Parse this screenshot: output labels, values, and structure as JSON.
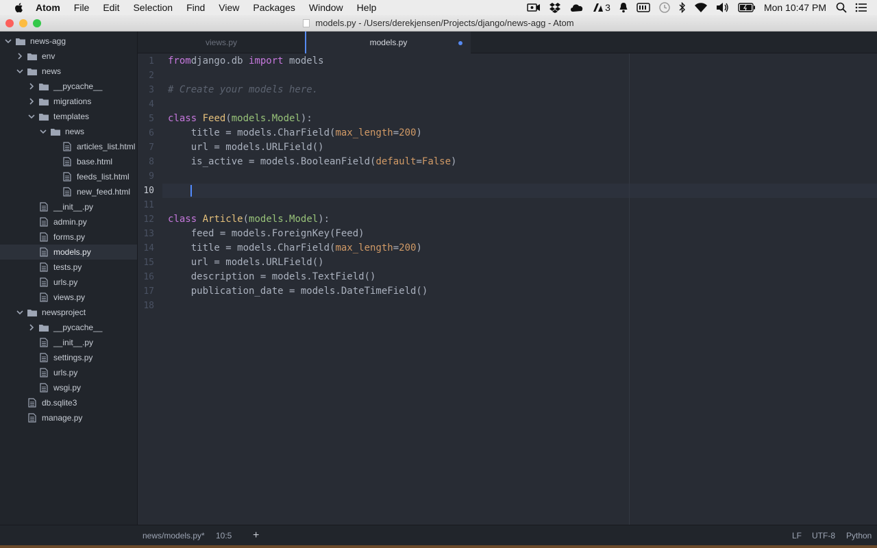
{
  "menubar": {
    "app_name": "Atom",
    "items": [
      "File",
      "Edit",
      "Selection",
      "Find",
      "View",
      "Packages",
      "Window",
      "Help"
    ],
    "status_icons": [
      "video-icon",
      "dropbox-icon",
      "cloud-icon",
      "adobe-icon",
      "notification-bell-icon",
      "keyboard-icon",
      "time-machine-icon",
      "bluetooth-icon",
      "wifi-icon",
      "volume-icon",
      "battery-icon"
    ],
    "adobe_count": "3",
    "clock": "Mon 10:47 PM"
  },
  "window": {
    "title": "models.py - /Users/derekjensen/Projects/django/news-agg - Atom",
    "traffic_lights": {
      "close": "#fc605b",
      "minimize": "#fdbc40",
      "zoom": "#34c84a"
    }
  },
  "tree": {
    "root": "news-agg",
    "items": [
      {
        "label": "env",
        "type": "folder",
        "expanded": false,
        "depth": 1
      },
      {
        "label": "news",
        "type": "folder",
        "expanded": true,
        "depth": 1
      },
      {
        "label": "__pycache__",
        "type": "folder",
        "expanded": false,
        "depth": 2
      },
      {
        "label": "migrations",
        "type": "folder",
        "expanded": false,
        "depth": 2
      },
      {
        "label": "templates",
        "type": "folder",
        "expanded": true,
        "depth": 2
      },
      {
        "label": "news",
        "type": "folder",
        "expanded": true,
        "depth": 3
      },
      {
        "label": "articles_list.html",
        "type": "file",
        "depth": 4
      },
      {
        "label": "base.html",
        "type": "file",
        "depth": 4
      },
      {
        "label": "feeds_list.html",
        "type": "file",
        "depth": 4
      },
      {
        "label": "new_feed.html",
        "type": "file",
        "depth": 4
      },
      {
        "label": "__init__.py",
        "type": "file",
        "depth": 2
      },
      {
        "label": "admin.py",
        "type": "file",
        "depth": 2
      },
      {
        "label": "forms.py",
        "type": "file",
        "depth": 2
      },
      {
        "label": "models.py",
        "type": "file",
        "depth": 2,
        "selected": true
      },
      {
        "label": "tests.py",
        "type": "file",
        "depth": 2
      },
      {
        "label": "urls.py",
        "type": "file",
        "depth": 2
      },
      {
        "label": "views.py",
        "type": "file",
        "depth": 2
      },
      {
        "label": "newsproject",
        "type": "folder",
        "expanded": true,
        "depth": 1
      },
      {
        "label": "__pycache__",
        "type": "folder",
        "expanded": false,
        "depth": 2
      },
      {
        "label": "__init__.py",
        "type": "file",
        "depth": 2
      },
      {
        "label": "settings.py",
        "type": "file",
        "depth": 2
      },
      {
        "label": "urls.py",
        "type": "file",
        "depth": 2
      },
      {
        "label": "wsgi.py",
        "type": "file",
        "depth": 2
      },
      {
        "label": "db.sqlite3",
        "type": "file",
        "depth": 1
      },
      {
        "label": "manage.py",
        "type": "file",
        "depth": 1
      }
    ]
  },
  "tabs": [
    {
      "label": "views.py",
      "active": false
    },
    {
      "label": "models.py",
      "active": true,
      "modified": true
    }
  ],
  "editor": {
    "current_line": 10,
    "lines": [
      [
        [
          "kw",
          "from"
        ],
        [
          "",
          "django.db "
        ],
        [
          "kw",
          "import"
        ],
        [
          "",
          " models"
        ]
      ],
      [],
      [
        [
          "cm",
          "# Create your models here."
        ]
      ],
      [],
      [
        [
          "kw",
          "class"
        ],
        [
          "",
          " "
        ],
        [
          "cls",
          "Feed"
        ],
        [
          "",
          "("
        ],
        [
          "inh",
          "models.Model"
        ],
        [
          "",
          "):"
        ]
      ],
      [
        [
          "",
          "    title = models.CharField("
        ],
        [
          "par",
          "max_length"
        ],
        [
          "",
          "="
        ],
        [
          "num",
          "200"
        ],
        [
          "",
          ")"
        ]
      ],
      [
        [
          "",
          "    url = models.URLField()"
        ]
      ],
      [
        [
          "",
          "    is_active = models.BooleanField("
        ],
        [
          "par",
          "default"
        ],
        [
          "",
          "="
        ],
        [
          "con",
          "False"
        ],
        [
          "",
          ")"
        ]
      ],
      [],
      [],
      [],
      [
        [
          "kw",
          "class"
        ],
        [
          "",
          " "
        ],
        [
          "cls",
          "Article"
        ],
        [
          "",
          "("
        ],
        [
          "inh",
          "models.Model"
        ],
        [
          "",
          "):"
        ]
      ],
      [
        [
          "",
          "    feed = models.ForeignKey(Feed)"
        ]
      ],
      [
        [
          "",
          "    title = models.CharField("
        ],
        [
          "par",
          "max_length"
        ],
        [
          "",
          "="
        ],
        [
          "num",
          "200"
        ],
        [
          "",
          ")"
        ]
      ],
      [
        [
          "",
          "    url = models.URLField()"
        ]
      ],
      [
        [
          "",
          "    description = models.TextField()"
        ]
      ],
      [
        [
          "",
          "    publication_date = models.DateTimeField()"
        ]
      ],
      []
    ]
  },
  "statusbar": {
    "file_path": "news/models.py*",
    "cursor_position": "10:5",
    "add_label": "+",
    "line_ending": "LF",
    "encoding": "UTF-8",
    "grammar": "Python"
  }
}
